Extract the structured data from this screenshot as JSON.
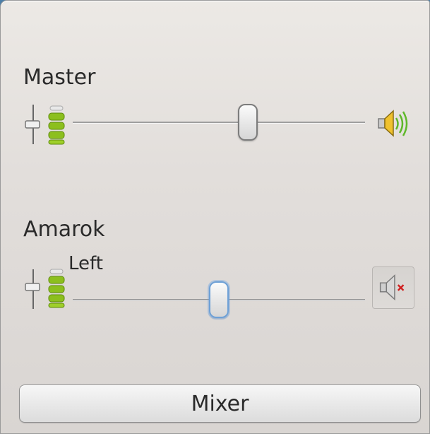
{
  "channels": [
    {
      "name": "Master",
      "sub_label": "",
      "volume_fraction": 0.6,
      "muted": false,
      "speaker_icon": "speaker-volume-icon",
      "knob_focused": false
    },
    {
      "name": "Amarok",
      "sub_label": "Left",
      "volume_fraction": 0.5,
      "muted": true,
      "speaker_icon": "speaker-muted-icon",
      "knob_focused": true
    }
  ],
  "mixer_button": {
    "label": "Mixer"
  },
  "colors": {
    "accent_focus": "#6da0d6",
    "meter_green": "#8cbf1e",
    "speaker_waves_green": "#5fb82a",
    "mute_red": "#d02020"
  }
}
